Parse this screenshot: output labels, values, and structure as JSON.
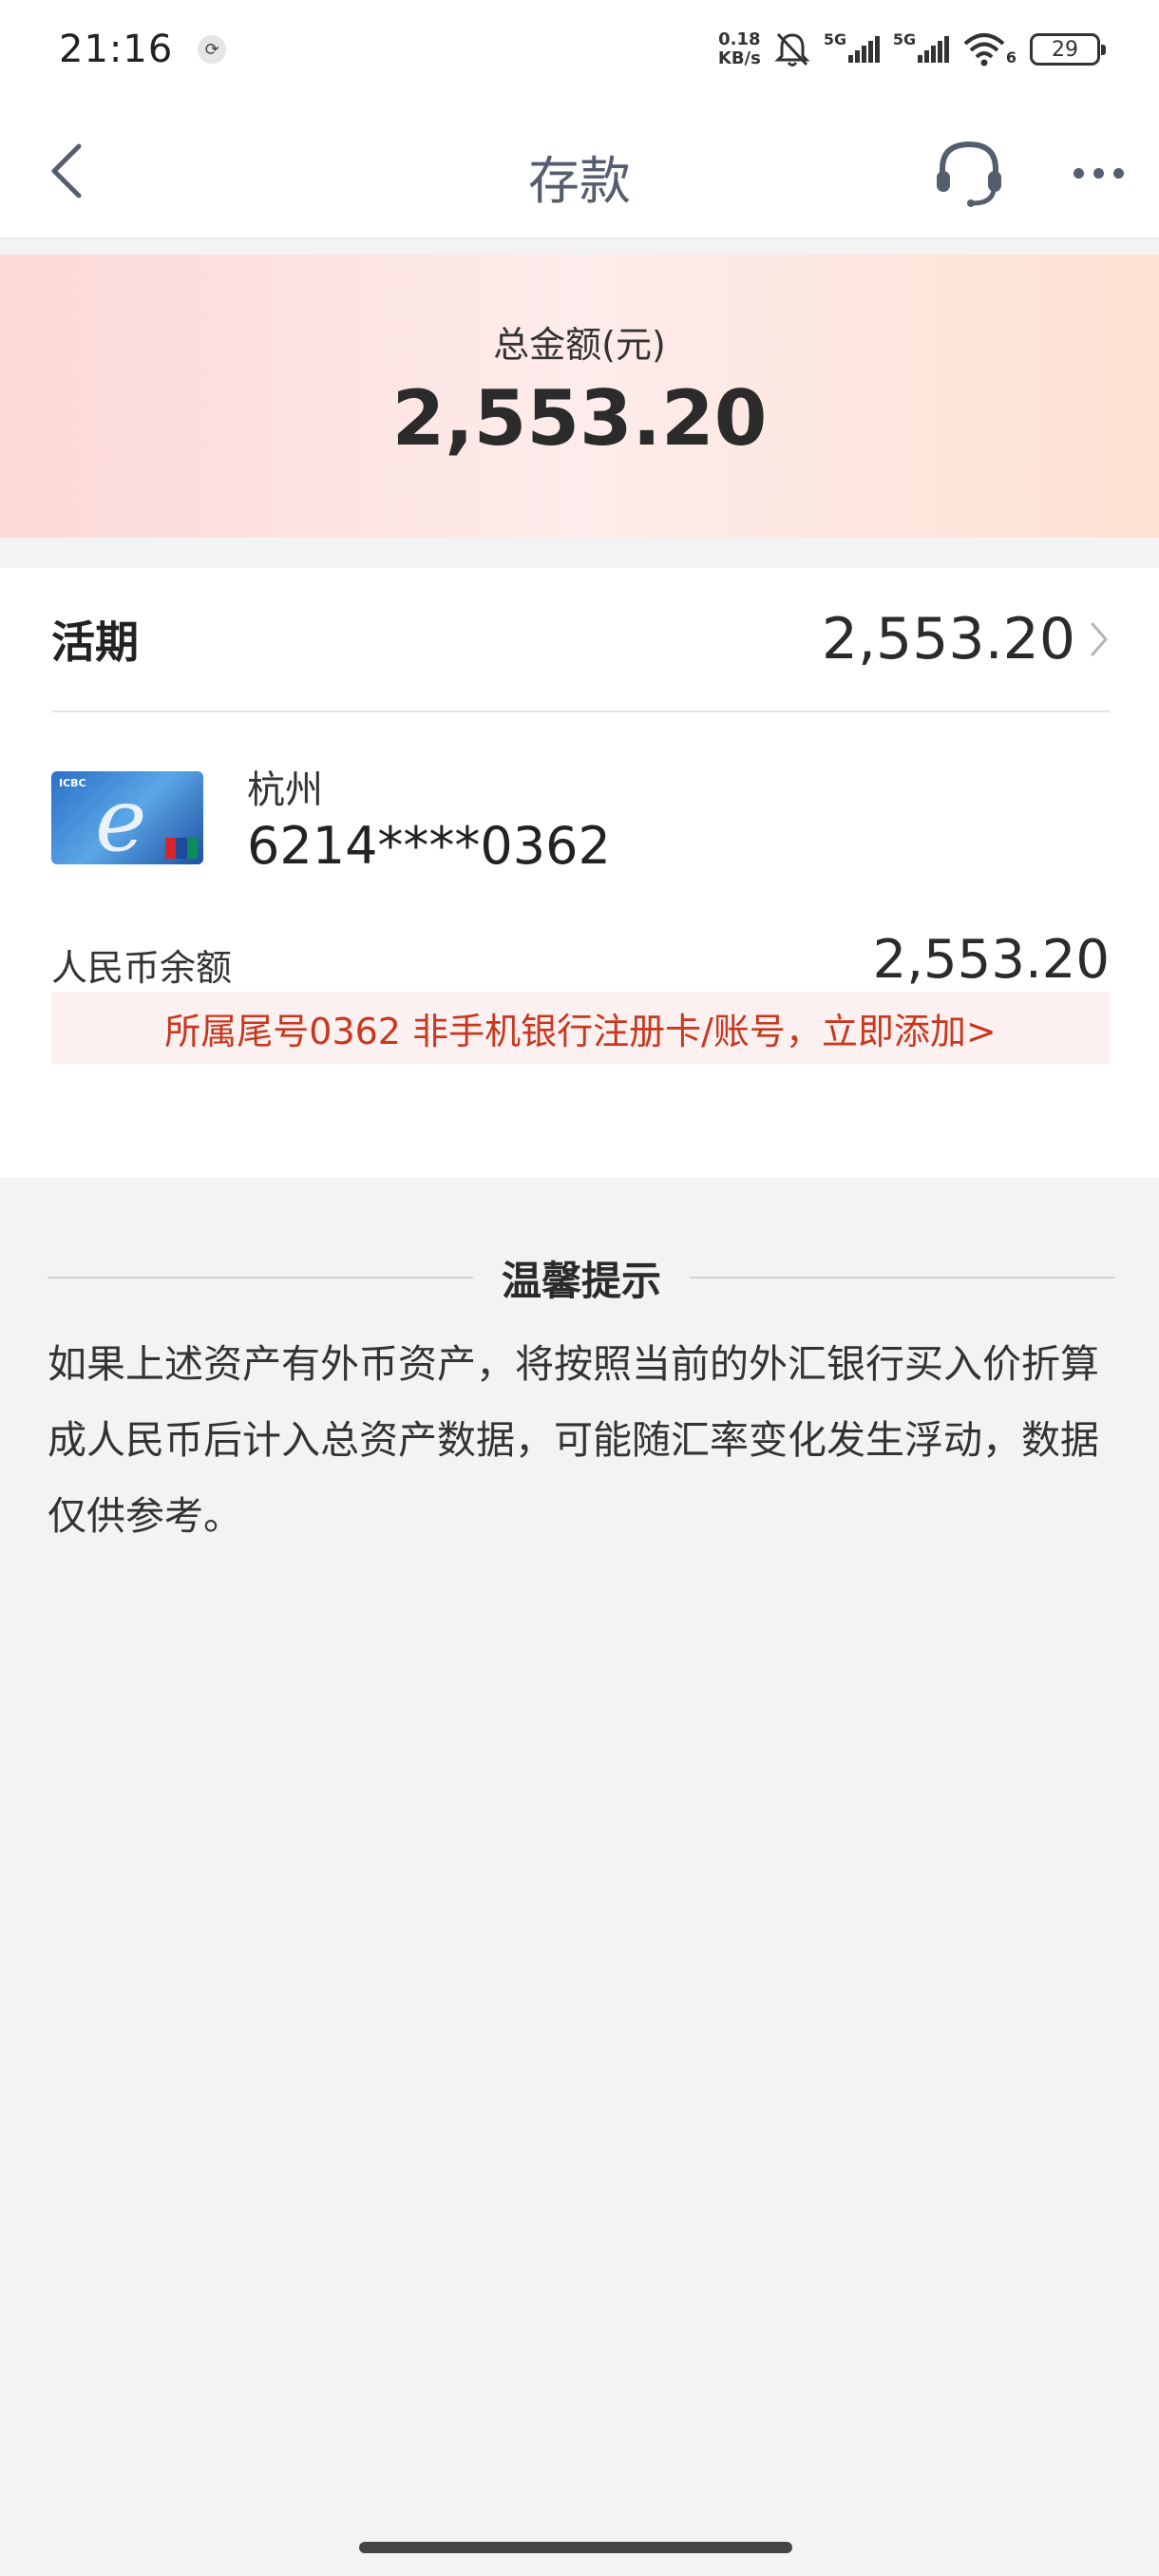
{
  "status_bar": {
    "time": "21:16",
    "net_speed_value": "0.18",
    "net_speed_unit": "KB/s",
    "signal1_label": "5G",
    "signal2_label": "5G",
    "wifi_sub": "6",
    "battery": "29",
    "icons": [
      "sync-icon",
      "bell-muted-icon",
      "signal-icon",
      "wifi-icon",
      "battery-icon"
    ]
  },
  "nav": {
    "title": "存款",
    "icons": [
      "back-arrow-icon",
      "headset-icon",
      "more-icon"
    ]
  },
  "total": {
    "label": "总金额(元)",
    "amount": "2,553.20"
  },
  "demand": {
    "label": "活期",
    "amount": "2,553.20"
  },
  "account": {
    "card_brand": "ICBC",
    "city": "杭州",
    "number": "6214****0362",
    "balance_label": "人民币余额",
    "balance": "2,553.20",
    "notice": "所属尾号0362 非手机银行注册卡/账号，立即添加>"
  },
  "tips": {
    "title": "温馨提示",
    "text": "如果上述资产有外币资产，将按照当前的外汇银行买入价折算成人民币后计入总资产数据，可能随汇率变化发生浮动，数据仅供参考。"
  },
  "colors": {
    "accent_red": "#c8381e",
    "notice_bg": "#fdf0f0",
    "banner_start": "#fcd8d6",
    "banner_end": "#fde1d2",
    "page_bg": "#f3f3f3"
  }
}
